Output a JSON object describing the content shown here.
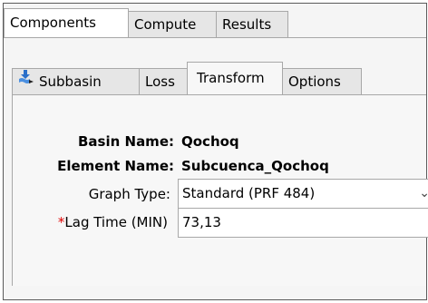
{
  "main_tabs": [
    {
      "label": "Components",
      "active": true
    },
    {
      "label": "Compute",
      "active": false
    },
    {
      "label": "Results",
      "active": false
    }
  ],
  "element_tabs": [
    {
      "label": "Subbasin",
      "icon": "subbasin-icon",
      "active": false
    },
    {
      "label": "Loss",
      "active": false
    },
    {
      "label": "Transform",
      "active": true
    },
    {
      "label": "Options",
      "active": false
    }
  ],
  "form": {
    "basin_name_label": "Basin Name:",
    "basin_name_value": "Qochoq",
    "element_name_label": "Element Name:",
    "element_name_value": "Subcuenca_Qochoq",
    "graph_type_label": "Graph Type:",
    "graph_type_value": "Standard (PRF 484)",
    "lag_time_required_mark": "*",
    "lag_time_label": "Lag Time (MIN)",
    "lag_time_value": "73,13"
  },
  "colors": {
    "required": "#e00000",
    "active_tab": "#ffffff",
    "inactive_tab": "#e6e6e6"
  }
}
